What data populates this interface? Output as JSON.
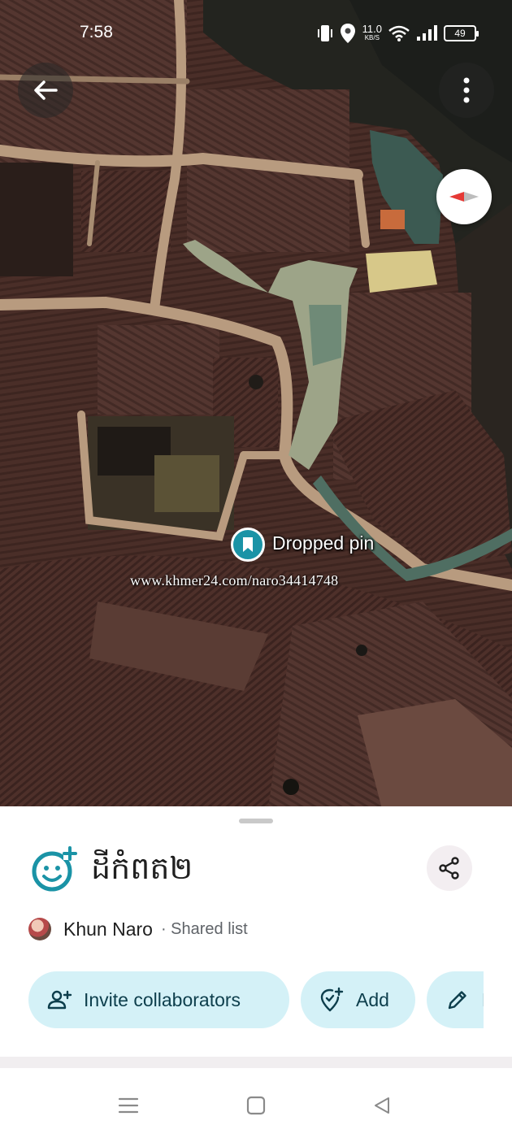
{
  "status_bar": {
    "time": "7:58",
    "net_speed_value": "11.0",
    "net_speed_unit": "KB/S",
    "battery_level": "49"
  },
  "map": {
    "pin_label": "Dropped pin",
    "watermark": "www.khmer24.com/naro34414748",
    "pin_color": "#1a93a6"
  },
  "list": {
    "title": "ដីកំពត២",
    "owner_name": "Khun Naro",
    "visibility": "· Shared list",
    "icon": "add-reaction-icon"
  },
  "actions": {
    "invite_label": "Invite collaborators",
    "add_label": "Add",
    "edit_label": "E"
  },
  "colors": {
    "accent": "#1a93a6",
    "chip_bg": "#d4f1f7",
    "chip_text": "#0d3e4c",
    "share_bg": "#f3eef1"
  }
}
